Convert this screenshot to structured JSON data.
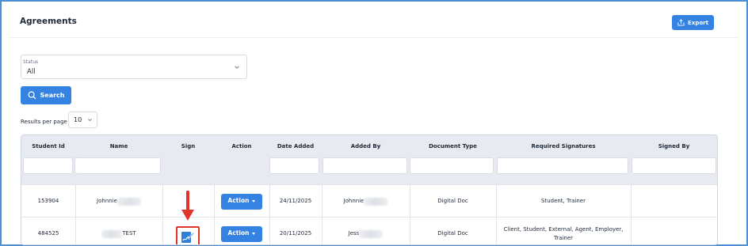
{
  "page": {
    "title": "Agreements",
    "export_label": "Export"
  },
  "filters": {
    "status_label": "Status",
    "status_value": "All",
    "search_label": "Search",
    "results_per_page_label": "Results per page",
    "results_per_page_value": "10"
  },
  "table": {
    "columns": [
      "Student Id",
      "Name",
      "Sign",
      "Action",
      "Date Added",
      "Added By",
      "Document Type",
      "Required Signatures",
      "Signed By"
    ],
    "rows": [
      {
        "student_id": "153904",
        "name": "Johnnie",
        "action_label": "Action",
        "date_added": "24/11/2025",
        "added_by": "Johnnie",
        "document_type": "Digital Doc",
        "required_signatures": "Student, Trainer",
        "signed_by": ""
      },
      {
        "student_id": "484525",
        "name": "TEST",
        "action_label": "Action",
        "date_added": "20/11/2025",
        "added_by": "Jess",
        "document_type": "Digital Doc",
        "required_signatures_line1": "Client, Student, External, Agent, Employer,",
        "required_signatures_line2": "Trainer",
        "signed_by": ""
      }
    ]
  },
  "icons": {
    "export": "upload-icon",
    "search": "search-icon",
    "sign": "sign-document-icon",
    "annotation": "red-arrow-annotation"
  },
  "colors": {
    "accent": "#3483e3",
    "annotation": "#e0352b",
    "frame": "#4a90d9"
  }
}
